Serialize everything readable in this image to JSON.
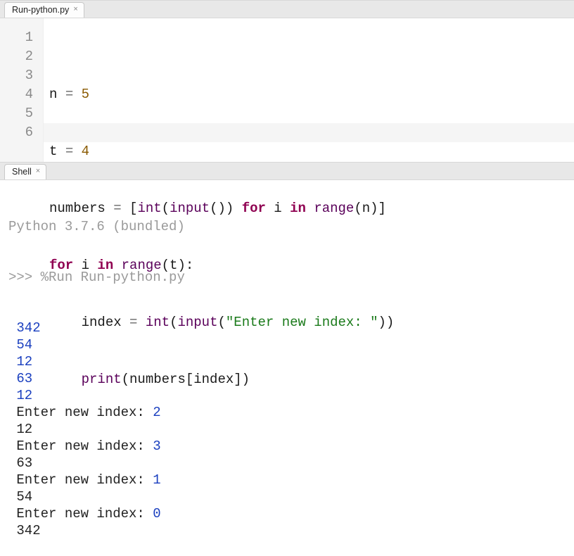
{
  "editor": {
    "tab_label": "Run-python.py",
    "close_glyph": "×",
    "line_numbers": [
      "1",
      "2",
      "3",
      "4",
      "5",
      "6"
    ],
    "code": {
      "l1": {
        "a": "n ",
        "b": "= ",
        "c": "5"
      },
      "l2": {
        "a": "t ",
        "b": "= ",
        "c": "4"
      },
      "l3": {
        "a": "numbers ",
        "b": "= ",
        "c": "[",
        "d": "int",
        "e": "(",
        "f": "input",
        "g": "()) ",
        "h": "for ",
        "i": "i ",
        "j": "in ",
        "k": "range",
        "l": "(n)]"
      },
      "l4": {
        "a": "for ",
        "b": "i ",
        "c": "in ",
        "d": "range",
        "e": "(t):"
      },
      "l5": {
        "a": "    index ",
        "b": "= ",
        "c": "int",
        "d": "(",
        "e": "input",
        "f": "(",
        "g": "\"Enter new index: \"",
        "h": "))"
      },
      "l6": {
        "a": "    ",
        "b": "print",
        "c": "(numbers[index])"
      }
    }
  },
  "shell": {
    "tab_label": "Shell",
    "close_glyph": "×",
    "banner": "Python 3.7.6 (bundled)",
    "prompt": ">>> ",
    "run_cmd": "%Run Run-python.py",
    "io": [
      {
        "kind": "in",
        "text": "342"
      },
      {
        "kind": "in",
        "text": "54"
      },
      {
        "kind": "in",
        "text": "12"
      },
      {
        "kind": "in",
        "text": "63"
      },
      {
        "kind": "in",
        "text": "12"
      },
      {
        "kind": "out",
        "text": "Enter new index: ",
        "resp": "2"
      },
      {
        "kind": "out",
        "text": "12"
      },
      {
        "kind": "out",
        "text": "Enter new index: ",
        "resp": "3"
      },
      {
        "kind": "out",
        "text": "63"
      },
      {
        "kind": "out",
        "text": "Enter new index: ",
        "resp": "1"
      },
      {
        "kind": "out",
        "text": "54"
      },
      {
        "kind": "out",
        "text": "Enter new index: ",
        "resp": "0"
      },
      {
        "kind": "out",
        "text": "342"
      }
    ]
  }
}
